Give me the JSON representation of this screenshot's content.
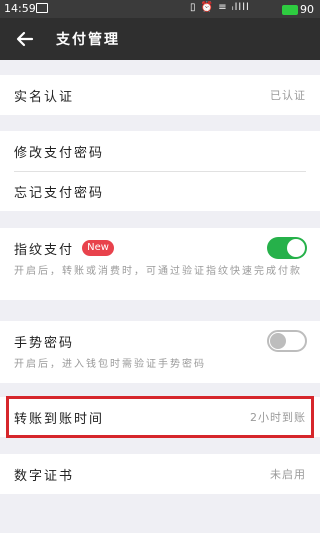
{
  "statusbar": {
    "time": "14:59",
    "right_icons": "▯ ⏰ ≡ ᵢllll ",
    "battery": "90"
  },
  "nav": {
    "title": "支付管理"
  },
  "rows": {
    "real_name": {
      "label": "实名认证",
      "value": "已认证"
    },
    "change_pwd": {
      "label": "修改支付密码"
    },
    "forgot_pwd": {
      "label": "忘记支付密码"
    },
    "fingerprint": {
      "label": "指纹支付",
      "badge": "New",
      "toggle": "on",
      "desc": "开启后，转账或消费时，可通过验证指纹快速完成付款"
    },
    "gesture": {
      "label": "手势密码",
      "toggle": "off",
      "desc": "开启后，进入钱包时需验证手势密码"
    },
    "transfer_time": {
      "label": "转账到账时间",
      "value": "2小时到账"
    },
    "certificate": {
      "label": "数字证书",
      "value": "未启用"
    }
  },
  "colors": {
    "toggle_on": "#26b14a",
    "badge": "#e8424c",
    "highlight": "#d6262b"
  }
}
